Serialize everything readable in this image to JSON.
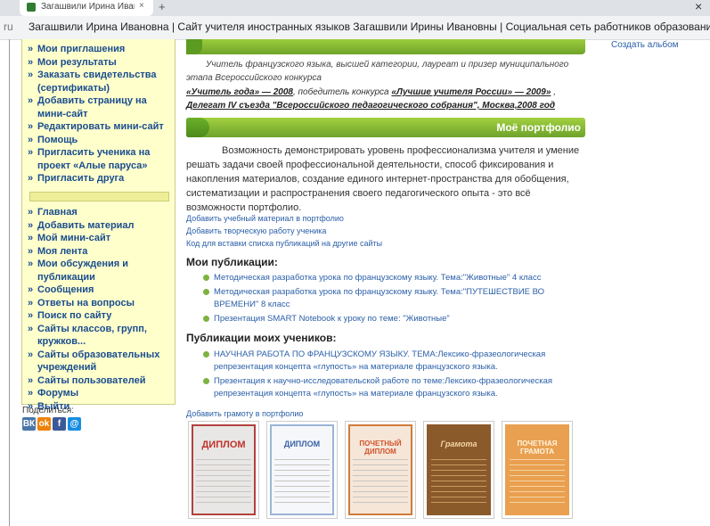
{
  "browser": {
    "tab_title": "Загашвили Ирина Иван",
    "tab_close": "×",
    "new_tab": "+",
    "window_close": "×",
    "title_prefix": "ru",
    "window_title": "Загашвили Ирина Ивановна | Сайт учителя иностранных языков Загашвили Ирины Ивановны | Социальная сеть работников образования"
  },
  "sidebar": {
    "bullet": "»",
    "items_top": [
      "Мои приглашения",
      "Мои результаты",
      "Заказать свидетельства (сертификаты)",
      "Добавить страницу на мини-сайт",
      "Редактировать мини-сайт",
      "Помощь",
      "Пригласить ученика на проект «Алые паруса»",
      "Пригласить друга"
    ],
    "items_bottom": [
      "Главная",
      "Добавить материал",
      "Мой мини-сайт",
      "Моя лента",
      "Мои обсуждения и публикации",
      "Сообщения",
      "Ответы на вопросы",
      "Поиск по сайту",
      "Сайты классов, групп, кружков...",
      "Сайты образовательных учреждений",
      "Сайты пользователей",
      "Форумы",
      "Выйти"
    ],
    "share_label": "Поделиться:",
    "share_buttons": [
      "ВК",
      "ok",
      "f",
      "@"
    ]
  },
  "right": {
    "create_album": "Создать альбом"
  },
  "main": {
    "teacher_desc": "Учитель французского языка, высшей категории, лауреат и призер муниципального этапа Всероссийского конкурса",
    "award1_title": "«Учитель года» — 2008",
    "award1_mid": ", победитель конкурса ",
    "award2_title": "«Лучшие учителя России» — 2009»",
    "award2_end": " ,",
    "award3_title": "Делегат IV съезда \"Всероссийского педагогического собрания\", Москва,2008 год",
    "portfolio_title": "Моё портфолио",
    "portfolio_text": "Возможность демонстрировать уровень профессионализма учителя и умение решать задачи своей профессиональной деятельности, способ фиксирования и накопления материалов, создание единого интернет-пространства для обобщения, систематизации и распространения своего педагогического опыта - это всё возможности портфолио.",
    "link_add_material": "Добавить учебный материал в портфолио",
    "link_add_student_work": "Добавить творческую работу ученика",
    "link_embed_code": "Код для вставки списка публикаций на другие сайты",
    "my_pubs_heading": "Мои публикации:",
    "my_pubs": [
      "Методическая разработка урока по французскому языку. Тема:\"Животные\" 4 класс",
      "Методическая разработка урока по французскому языку. Тема:\"ПУТЕШЕСТВИЕ ВО ВРЕМЕНИ\" 8 класс",
      "Презентация SMART Notebook к уроку по теме: \"Животные\""
    ],
    "student_pubs_heading": "Публикации моих учеников:",
    "student_pubs": [
      "НАУЧНАЯ РАБОТА ПО ФРАНЦУЗСКОМУ ЯЗЫКУ. ТЕМА:Лексико-фразеологическая репрезентация концепта «глупость» на материале французского языка.",
      "Презентация к научно-исследовательской работе по теме:Лексико-фразеологическая репрезентация концепта «глупость» на материале французского языка."
    ],
    "link_add_certificate": "Добавить грамоту в портфолио",
    "certificates": [
      "ДИПЛОМ",
      "ДИПЛОМ",
      "ПОЧЕТНЫЙ ДИПЛОМ",
      "Грамота",
      "ПОЧЕТНАЯ ГРАМОТА"
    ]
  }
}
